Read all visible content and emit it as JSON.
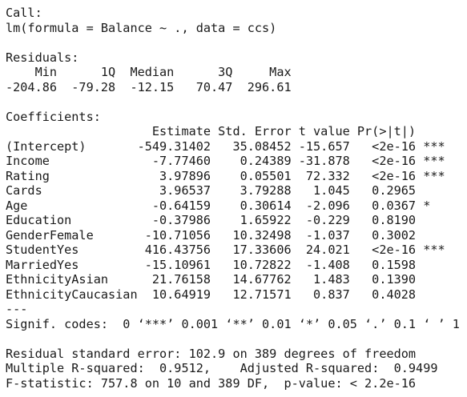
{
  "console": {
    "lines": [
      "Call:",
      "lm(formula = Balance ~ ., data = ccs)",
      "",
      "Residuals:",
      "    Min      1Q  Median      3Q     Max ",
      "-204.86  -79.28  -12.15   70.47  296.61 ",
      "",
      "Coefficients:",
      "                    Estimate Std. Error t value Pr(>|t|)    ",
      "(Intercept)       -549.31402   35.08452 -15.657   <2e-16 ***",
      "Income              -7.77460    0.24389 -31.878   <2e-16 ***",
      "Rating               3.97896    0.05501  72.332   <2e-16 ***",
      "Cards                3.96537    3.79288   1.045   0.2965    ",
      "Age                 -0.64159    0.30614  -2.096   0.0367 *  ",
      "Education           -0.37986    1.65922  -0.229   0.8190    ",
      "GenderFemale       -10.71056   10.32498  -1.037   0.3002    ",
      "StudentYes         416.43756   17.33606  24.021   <2e-16 ***",
      "MarriedYes         -15.10961   10.72822  -1.408   0.1598    ",
      "EthnicityAsian      21.76158   14.67762   1.483   0.1390    ",
      "EthnicityCaucasian  10.64919   12.71571   0.837   0.4028    ",
      "---",
      "Signif. codes:  0 ‘***’ 0.001 ‘**’ 0.01 ‘*’ 0.05 ‘.’ 0.1 ‘ ’ 1",
      "",
      "Residual standard error: 102.9 on 389 degrees of freedom",
      "Multiple R-squared:  0.9512,\tAdjusted R-squared:  0.9499 ",
      "F-statistic: 757.8 on 10 and 389 DF,  p-value: < 2.2e-16"
    ]
  }
}
